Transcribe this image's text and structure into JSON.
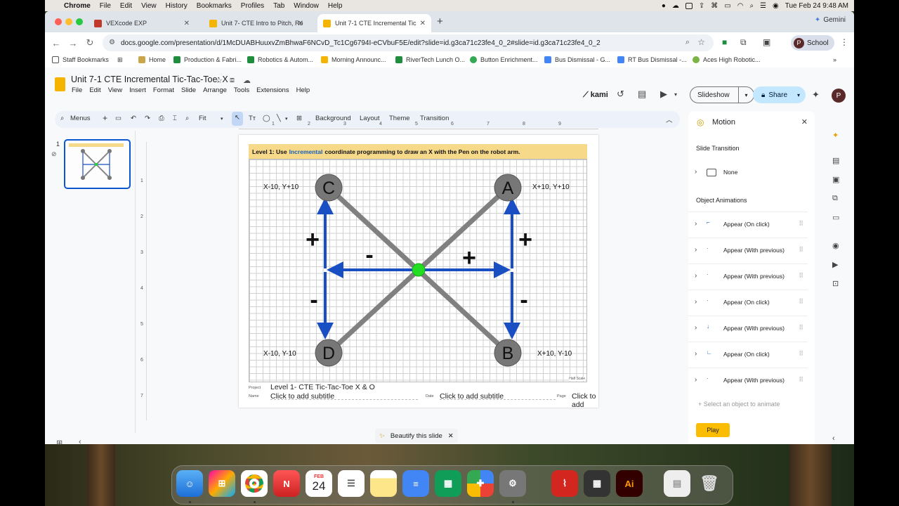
{
  "menubar": {
    "app": "Chrome",
    "items": [
      "File",
      "Edit",
      "View",
      "History",
      "Bookmarks",
      "Profiles",
      "Tab",
      "Window",
      "Help"
    ],
    "datetime": "Tue Feb 24  9:48 AM"
  },
  "tabs": [
    {
      "label": "VEXcode EXP",
      "color": "#c0392b"
    },
    {
      "label": "Unit 7- CTE Intro to Pitch, Ro",
      "color": "#f5b400"
    },
    {
      "label": "Unit 7-1 CTE Incremental Tic",
      "color": "#f5b400",
      "active": true
    }
  ],
  "gemini": "Gemini",
  "address": "docs.google.com/presentation/d/1McDUABHuuxvZmBhwaF6NCvD_Tc1Cg6794I-eCVbuF5E/edit?slide=id.g3ca71c23fe4_0_2#slide=id.g3ca71c23fe4_0_2",
  "profile": {
    "initial": "P",
    "label": "School"
  },
  "bookmarks": [
    "Staff Bookmarks",
    "Home",
    "Production & Fabri...",
    "Robotics & Autom...",
    "Morning Announc...",
    "RiverTech Lunch O...",
    "Button Enrichment...",
    "Bus Dismissal - G...",
    "RT Bus Dismissal -...",
    "Aces High Robotic..."
  ],
  "doc": {
    "title": "Unit 7-1 CTE Incremental Tic-Tac-Toe: X",
    "menus": [
      "File",
      "Edit",
      "View",
      "Insert",
      "Format",
      "Slide",
      "Arrange",
      "Tools",
      "Extensions",
      "Help"
    ],
    "kami": "kami",
    "slideshow": "Slideshow",
    "share": "Share"
  },
  "toolbar": {
    "menus": "Menus",
    "zoom": "Fit",
    "background": "Background",
    "layout": "Layout",
    "theme": "Theme",
    "transition": "Transition"
  },
  "ruler": [
    "1",
    "2",
    "3",
    "4",
    "5",
    "6",
    "7",
    "8",
    "9"
  ],
  "vruler": [
    "1",
    "2",
    "3",
    "4",
    "5",
    "6",
    "7"
  ],
  "filmstrip": {
    "number": "1"
  },
  "slide": {
    "banner_pre": "Level 1: Use",
    "banner_blue": "Incremental",
    "banner_post": "coordinate programming to draw an X with the Pen on the robot arm.",
    "points": {
      "A": "A",
      "B": "B",
      "C": "C",
      "D": "D"
    },
    "coords": {
      "C": "X-10, Y+10",
      "A": "X+10, Y+10",
      "D": "X-10, Y-10",
      "B": "X+10, Y-10"
    },
    "signs": {
      "left_up": "+",
      "right_up": "+",
      "center_left": "-",
      "center_right": "+",
      "left_down": "-",
      "right_down": "-"
    },
    "halfscale": "Half Scale",
    "footer": {
      "project_label": "Project",
      "project": "Level 1- CTE Tic-Tac-Toe X & O",
      "name_label": "Name",
      "name_placeholder": "Click to add subtitle",
      "date_label": "Date",
      "date_placeholder": "Click to add subtitle",
      "page_label": "Page",
      "page_placeholder": "Click to add"
    }
  },
  "beautify": "Beautify this slide",
  "motion": {
    "title": "Motion",
    "slide_transition": "Slide Transition",
    "transition_value": "None",
    "object_animations": "Object Animations",
    "animations": [
      {
        "label": "Appear  (On click)"
      },
      {
        "label": "Appear  (With previous)"
      },
      {
        "label": "Appear  (With previous)"
      },
      {
        "label": "Appear  (On click)"
      },
      {
        "label": "Appear  (With previous)"
      },
      {
        "label": "Appear  (On click)"
      },
      {
        "label": "Appear  (With previous)"
      }
    ],
    "select_hint": "+ Select an object to animate",
    "play": "Play"
  },
  "dock": {
    "calendar_month": "FEB",
    "calendar_day": "24",
    "illustrator": "Ai"
  },
  "colors": {
    "accent": "#0b57d0",
    "arrow": "#1a4fc4",
    "line": "#808080",
    "center": "#22dd22",
    "banner": "#f7d98a",
    "play": "#fbbc04"
  }
}
